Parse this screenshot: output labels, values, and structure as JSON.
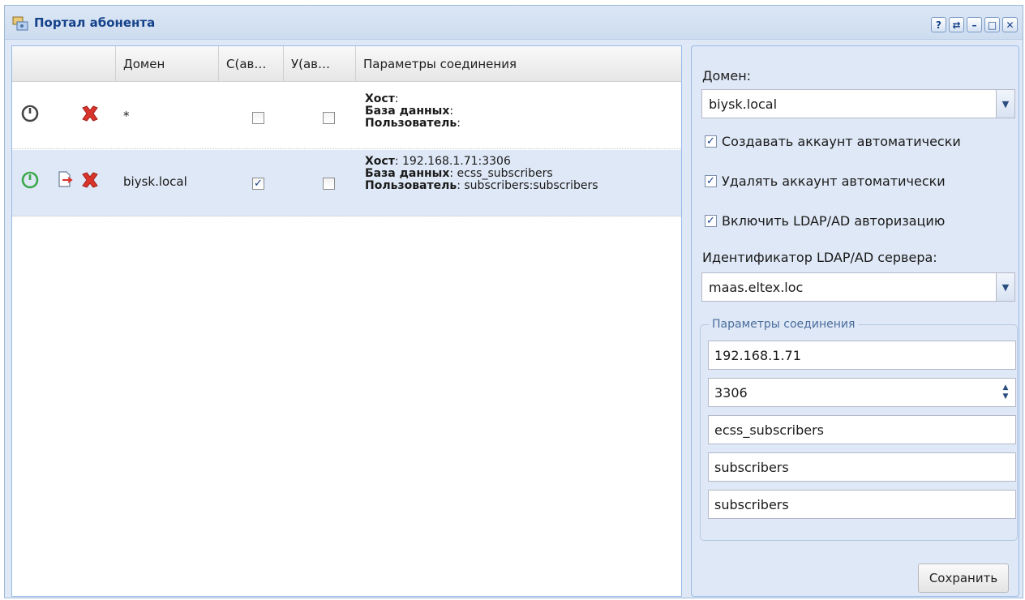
{
  "window": {
    "title": "Портал абонента",
    "tools": [
      "?",
      "⇄",
      "–",
      "□",
      "✕"
    ]
  },
  "grid": {
    "columns": [
      "",
      "Домен",
      "С(ав…",
      "У(ав…",
      "Параметры соединения"
    ],
    "rows": [
      {
        "domain": "*",
        "create_auto": false,
        "delete_auto": false,
        "enabled": false,
        "host_label": "Хост",
        "host_value": "",
        "db_label": "База данных",
        "db_value": "",
        "user_label": "Пользователь",
        "user_value": ""
      },
      {
        "domain": "biysk.local",
        "create_auto": true,
        "delete_auto": false,
        "enabled": true,
        "host_label": "Хост",
        "host_value": " 192.168.1.71:3306",
        "db_label": "База данных",
        "db_value": " ecss_subscribers",
        "user_label": "Пользователь",
        "user_value": " subscribers:subscribers"
      }
    ]
  },
  "form": {
    "domain_label": "Домен:",
    "domain_value": "biysk.local",
    "create_auto_label": "Создавать аккаунт автоматически",
    "delete_auto_label": "Удалять аккаунт автоматически",
    "ldap_label": "Включить LDAP/AD авторизацию",
    "create_auto_checked": true,
    "delete_auto_checked": true,
    "ldap_checked": true,
    "ldap_id_label": "Идентификатор LDAP/AD сервера:",
    "ldap_id_value": "maas.eltex.loc",
    "conn_legend": "Параметры соединения",
    "host": "192.168.1.71",
    "port": "3306",
    "database": "ecss_subscribers",
    "user": "subscribers",
    "password": "subscribers",
    "save_label": "Сохранить"
  },
  "colors": {
    "accent": "#15428b",
    "selected_row": "#dfe8f6",
    "enabled_icon": "#3aa84a",
    "disabled_icon": "#444444",
    "delete_icon": "#d9342b"
  }
}
